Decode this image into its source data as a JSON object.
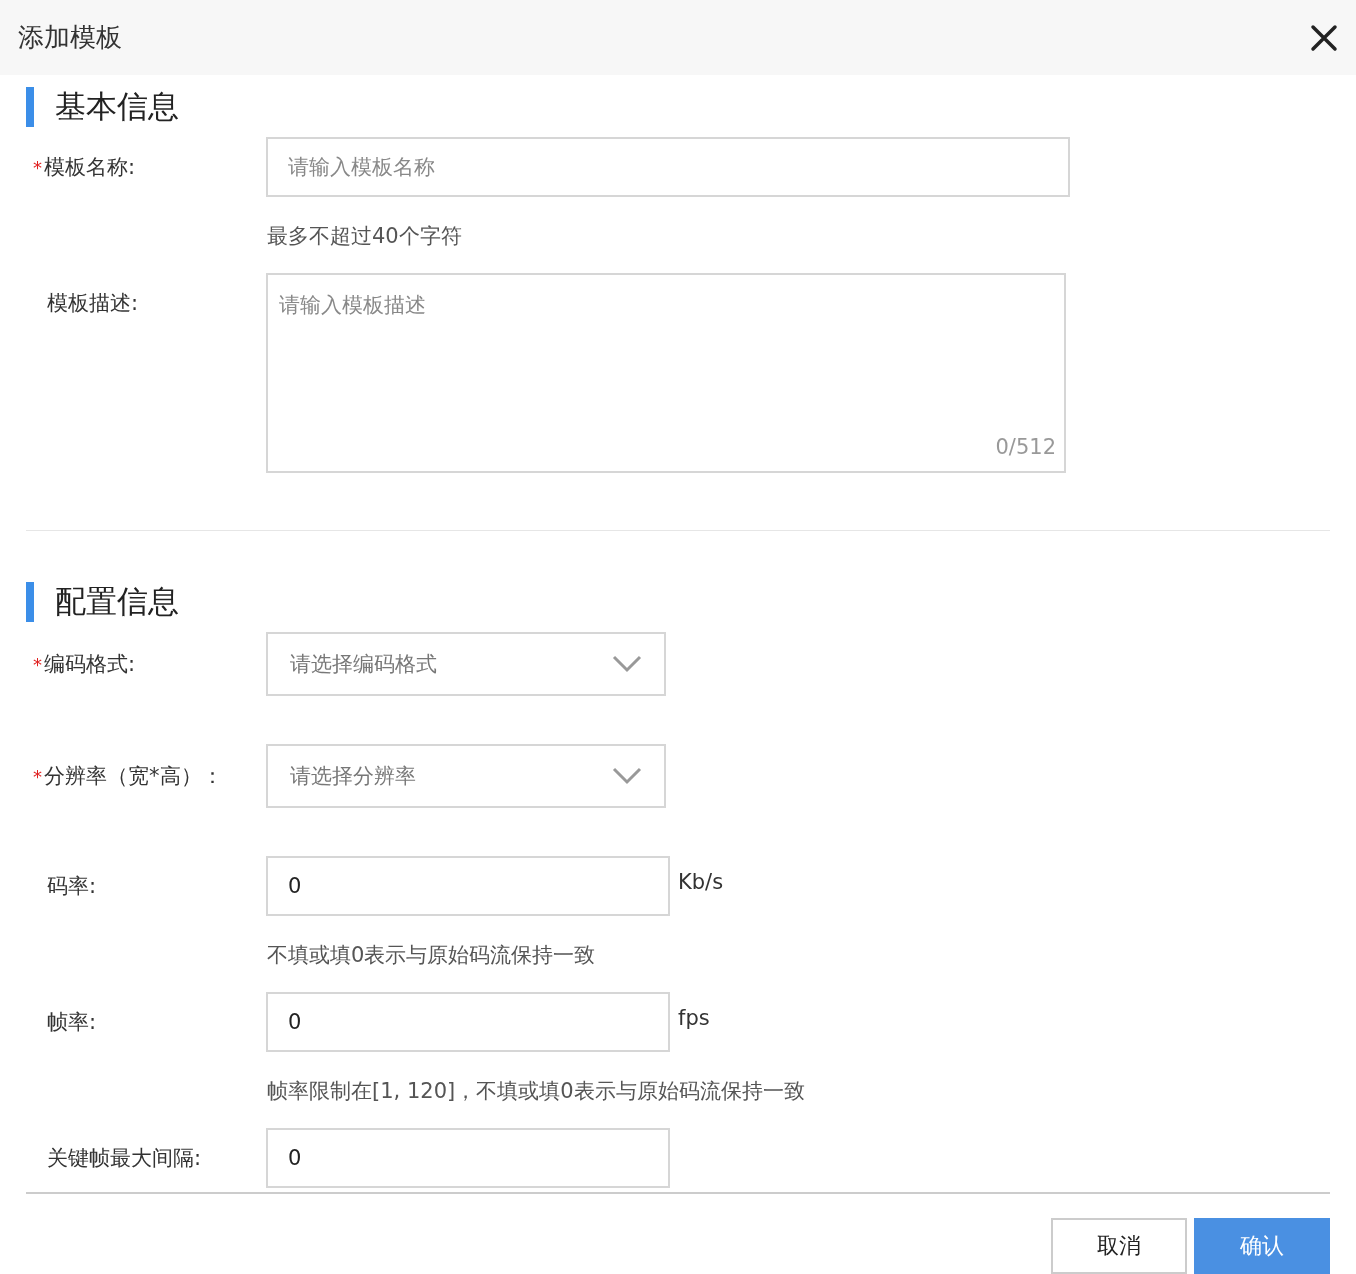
{
  "dialog": {
    "title": "添加模板"
  },
  "sections": [
    {
      "title": "基本信息",
      "fields": [
        {
          "kind": "text",
          "required_mark": "*",
          "label": "模板名称:",
          "placeholder": "请输入模板名称",
          "hint": "最多不超过40个字符"
        },
        {
          "kind": "textarea",
          "label": "模板描述:",
          "placeholder": "请输入模板描述",
          "counter": "0/512"
        }
      ]
    },
    {
      "title": "配置信息",
      "fields": [
        {
          "kind": "select",
          "required_mark": "*",
          "label": "编码格式:",
          "placeholder": "请选择编码格式"
        },
        {
          "kind": "select",
          "required_mark": "*",
          "label": "分辨率（宽*高）：",
          "placeholder": "请选择分辨率"
        },
        {
          "kind": "number",
          "label": "码率:",
          "value": "0",
          "unit": "Kb/s",
          "hint": "不填或填0表示与原始码流保持一致"
        },
        {
          "kind": "number",
          "label": "帧率:",
          "value": "0",
          "unit": "fps",
          "hint": "帧率限制在[1, 120]，不填或填0表示与原始码流保持一致"
        },
        {
          "kind": "number",
          "label": "关键帧最大间隔:",
          "value": "0"
        }
      ]
    }
  ],
  "buttons": [
    {
      "label": "取消",
      "kind": "secondary"
    },
    {
      "label": "确认",
      "kind": "primary"
    }
  ]
}
